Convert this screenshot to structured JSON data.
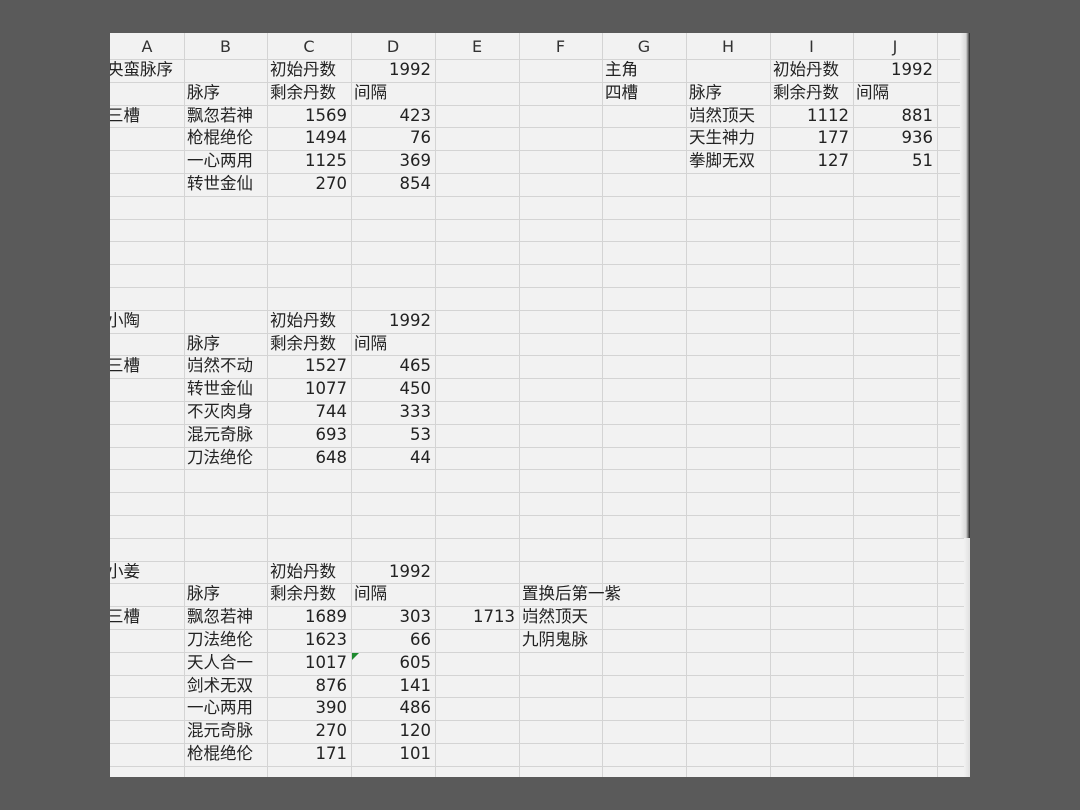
{
  "columns": [
    "A",
    "B",
    "C",
    "D",
    "E",
    "F",
    "G",
    "H",
    "I",
    "J"
  ],
  "blocks": {
    "b1": {
      "name": "央蛮脉序",
      "init_label": "初始丹数",
      "init_value": "1992",
      "slot": "三槽",
      "h_mai": "脉序",
      "h_rem": "剩余丹数",
      "h_gap": "间隔",
      "rows": [
        {
          "mai": "飘忽若神",
          "rem": "1569",
          "gap": "423"
        },
        {
          "mai": "枪棍绝伦",
          "rem": "1494",
          "gap": "76"
        },
        {
          "mai": "一心两用",
          "rem": "1125",
          "gap": "369"
        },
        {
          "mai": "转世金仙",
          "rem": "270",
          "gap": "854"
        }
      ]
    },
    "b2": {
      "name": "主角",
      "init_label": "初始丹数",
      "init_value": "1992",
      "slot": "四槽",
      "h_mai": "脉序",
      "h_rem": "剩余丹数",
      "h_gap": "间隔",
      "rows": [
        {
          "mai": "岿然顶天",
          "rem": "1112",
          "gap": "881"
        },
        {
          "mai": "天生神力",
          "rem": "177",
          "gap": "936"
        },
        {
          "mai": "拳脚无双",
          "rem": "127",
          "gap": "51"
        }
      ]
    },
    "b3": {
      "name": "小陶",
      "init_label": "初始丹数",
      "init_value": "1992",
      "slot": "三槽",
      "h_mai": "脉序",
      "h_rem": "剩余丹数",
      "h_gap": "间隔",
      "rows": [
        {
          "mai": "岿然不动",
          "rem": "1527",
          "gap": "465"
        },
        {
          "mai": "转世金仙",
          "rem": "1077",
          "gap": "450"
        },
        {
          "mai": "不灭肉身",
          "rem": "744",
          "gap": "333"
        },
        {
          "mai": "混元奇脉",
          "rem": "693",
          "gap": "53"
        },
        {
          "mai": "刀法绝伦",
          "rem": "648",
          "gap": "44"
        }
      ]
    },
    "b4": {
      "name": "小姜",
      "init_label": "初始丹数",
      "init_value": "1992",
      "slot": "三槽",
      "h_mai": "脉序",
      "h_rem": "剩余丹数",
      "h_gap": "间隔",
      "rows": [
        {
          "mai": "飘忽若神",
          "rem": "1689",
          "gap": "303"
        },
        {
          "mai": "刀法绝伦",
          "rem": "1623",
          "gap": "66"
        },
        {
          "mai": "天人合一",
          "rem": "1017",
          "gap": "605"
        },
        {
          "mai": "剑术无双",
          "rem": "876",
          "gap": "141"
        },
        {
          "mai": "一心两用",
          "rem": "390",
          "gap": "486"
        },
        {
          "mai": "混元奇脉",
          "rem": "270",
          "gap": "120"
        },
        {
          "mai": "枪棍绝伦",
          "rem": "171",
          "gap": "101"
        }
      ],
      "side_title": "置换后第一紫",
      "side_value": "1713",
      "side_items": [
        "岿然顶天",
        "九阴鬼脉"
      ]
    }
  }
}
